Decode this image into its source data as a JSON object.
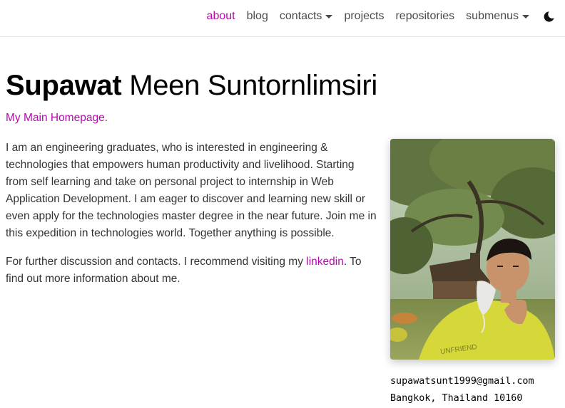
{
  "nav": {
    "items": [
      {
        "label": "about",
        "active": true,
        "dropdown": false
      },
      {
        "label": "blog",
        "active": false,
        "dropdown": false
      },
      {
        "label": "contacts",
        "active": false,
        "dropdown": true
      },
      {
        "label": "projects",
        "active": false,
        "dropdown": false
      },
      {
        "label": "repositories",
        "active": false,
        "dropdown": false
      },
      {
        "label": "submenus",
        "active": false,
        "dropdown": true
      }
    ],
    "theme_icon": "moon-icon"
  },
  "header": {
    "first_name": "Supawat",
    "rest_name": " Meen Suntornlimsiri",
    "homepage_link": "My Main Homepage",
    "homepage_suffix": "."
  },
  "about": {
    "paragraph1": "I am an engineering graduates, who is interested in engineering & technologies that empowers human productivity and livelihood. Starting from self learning and take on personal project to internship in Web Application Development. I am eager to discover and learning new skill or even apply for the technologies master degree in the near future. Join me in this expedition in technologies world. Together anything is possible.",
    "paragraph2_before": "For further discussion and contacts. I recommend visiting my ",
    "paragraph2_link": "linkedin",
    "paragraph2_after": ". To find out more information about me."
  },
  "profile": {
    "email": "supawatsunt1999@gmail.com",
    "location": "Bangkok, Thailand 10160"
  },
  "colors": {
    "accent": "#b509ac",
    "text": "#212529"
  }
}
